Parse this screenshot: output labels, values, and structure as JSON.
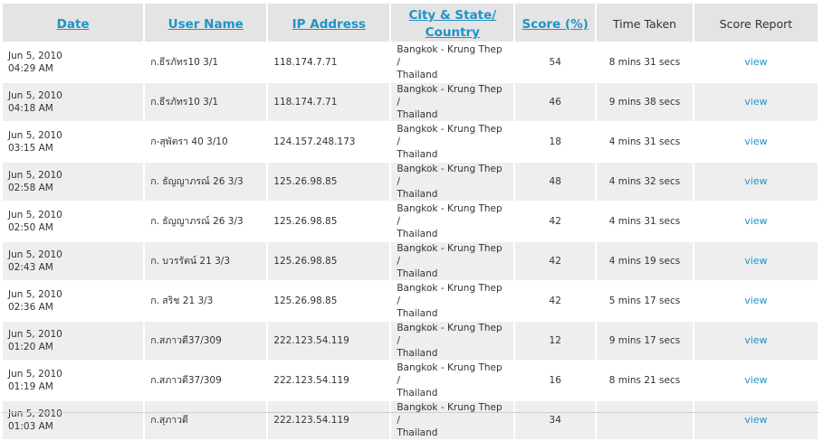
{
  "headers": {
    "date": "Date",
    "user": "User Name",
    "ip": "IP Address",
    "city": "City & State/ Country",
    "score": "Score (%)",
    "time": "Time Taken",
    "report": "Score Report"
  },
  "rows": [
    {
      "date": "Jun 5, 2010",
      "time_of_day": "04:29 AM",
      "user": "ก.ธีรภัทร10 3/1",
      "ip": "118.174.7.71",
      "city_line1": "Bangkok - Krung Thep /",
      "city_line2": "Thailand",
      "score": "54",
      "time_taken": "8 mins 31 secs",
      "report": "view"
    },
    {
      "date": "Jun 5, 2010",
      "time_of_day": "04:18 AM",
      "user": "ก.ธีรภัทร10 3/1",
      "ip": "118.174.7.71",
      "city_line1": "Bangkok - Krung Thep /",
      "city_line2": "Thailand",
      "score": "46",
      "time_taken": "9 mins 38 secs",
      "report": "view"
    },
    {
      "date": "Jun 5, 2010",
      "time_of_day": "03:15 AM",
      "user": "ก-สุพัตรา 40 3/10",
      "ip": "124.157.248.173",
      "city_line1": "Bangkok - Krung Thep /",
      "city_line2": "Thailand",
      "score": "18",
      "time_taken": "4 mins 31 secs",
      "report": "view"
    },
    {
      "date": "Jun 5, 2010",
      "time_of_day": "02:58 AM",
      "user": "ก. ธัญญาภรณ์ 26 3/3",
      "ip": "125.26.98.85",
      "city_line1": "Bangkok - Krung Thep /",
      "city_line2": "Thailand",
      "score": "48",
      "time_taken": "4 mins 32 secs",
      "report": "view"
    },
    {
      "date": "Jun 5, 2010",
      "time_of_day": "02:50 AM",
      "user": "ก. ธัญญาภรณ์ 26 3/3",
      "ip": "125.26.98.85",
      "city_line1": "Bangkok - Krung Thep /",
      "city_line2": "Thailand",
      "score": "42",
      "time_taken": "4 mins 31 secs",
      "report": "view"
    },
    {
      "date": "Jun 5, 2010",
      "time_of_day": "02:43 AM",
      "user": "ก. บวรรัตน์ 21 3/3",
      "ip": "125.26.98.85",
      "city_line1": "Bangkok - Krung Thep /",
      "city_line2": "Thailand",
      "score": "42",
      "time_taken": "4 mins 19 secs",
      "report": "view"
    },
    {
      "date": "Jun 5, 2010",
      "time_of_day": "02:36 AM",
      "user": "ก. สริช 21 3/3",
      "ip": "125.26.98.85",
      "city_line1": "Bangkok - Krung Thep /",
      "city_line2": "Thailand",
      "score": "42",
      "time_taken": "5 mins 17 secs",
      "report": "view"
    },
    {
      "date": "Jun 5, 2010",
      "time_of_day": "01:20 AM",
      "user": "ก.สภาวดี37/309",
      "ip": "222.123.54.119",
      "city_line1": "Bangkok - Krung Thep /",
      "city_line2": "Thailand",
      "score": "12",
      "time_taken": "9 mins 17 secs",
      "report": "view"
    },
    {
      "date": "Jun 5, 2010",
      "time_of_day": "01:19 AM",
      "user": "ก.สภาวดี37/309",
      "ip": "222.123.54.119",
      "city_line1": "Bangkok - Krung Thep /",
      "city_line2": "Thailand",
      "score": "16",
      "time_taken": "8 mins 21 secs",
      "report": "view"
    },
    {
      "date": "Jun 5, 2010",
      "time_of_day": "01:03 AM",
      "user": "ก.สุภาวดี",
      "ip": "222.123.54.119",
      "city_line1": "Bangkok - Krung Thep /",
      "city_line2": "Thailand",
      "score": "34",
      "time_taken": "",
      "report": "view"
    }
  ],
  "colors": {
    "link": "#1f93c7",
    "header_bg": "#e4e4e4",
    "row_alt_bg": "#eeeeee",
    "text": "#333333"
  }
}
